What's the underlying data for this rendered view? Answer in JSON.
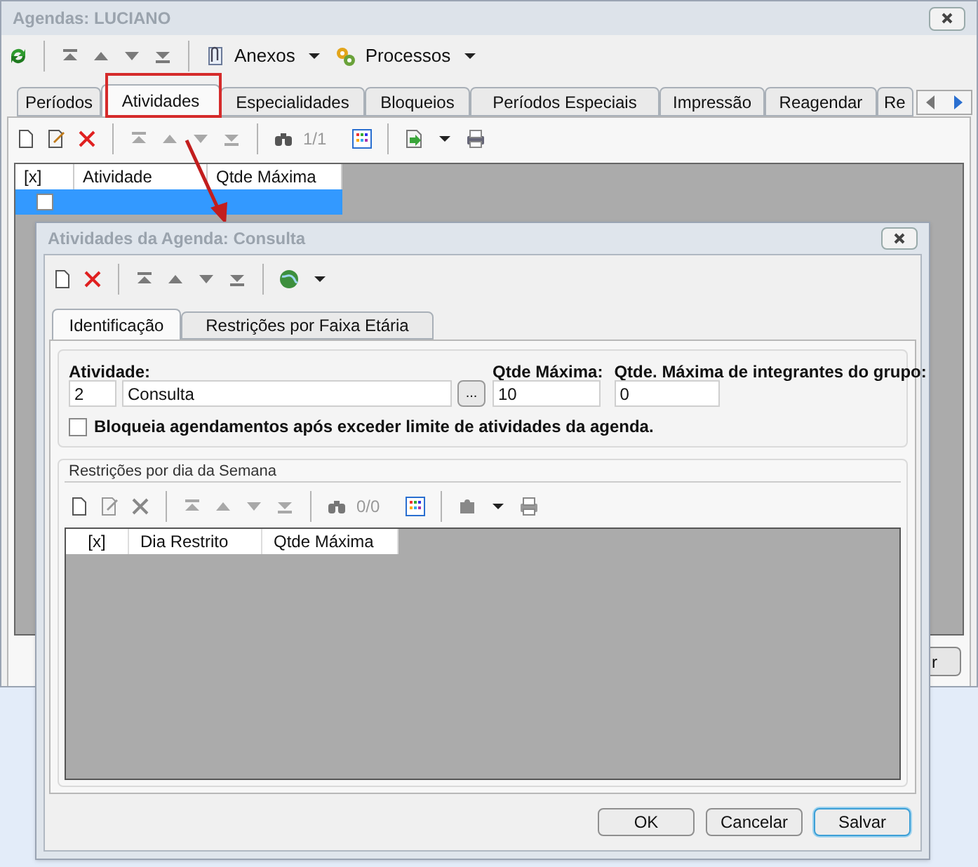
{
  "window": {
    "title": "Agendas: LUCIANO"
  },
  "toolbar": {
    "attachments": "Anexos",
    "processes": "Processos"
  },
  "tabs": [
    {
      "label": "Períodos",
      "selected": false
    },
    {
      "label": "Atividades",
      "selected": true
    },
    {
      "label": "Especialidades",
      "selected": false
    },
    {
      "label": "Bloqueios",
      "selected": false
    },
    {
      "label": "Períodos Especiais",
      "selected": false
    },
    {
      "label": "Impressão",
      "selected": false
    },
    {
      "label": "Reagendar",
      "selected": false
    },
    {
      "label": "Re",
      "selected": false
    }
  ],
  "grid_toolbar": {
    "counter": "1/1"
  },
  "table": {
    "columns": [
      "[x]",
      "Atividade",
      "Qtde Máxima"
    ],
    "rows": [
      {
        "checked": false,
        "selected": true
      }
    ]
  },
  "bottom_button": {
    "label": "r"
  },
  "dialog": {
    "title": "Atividades da Agenda: Consulta",
    "tabs": [
      {
        "label": "Identificação",
        "selected": true
      },
      {
        "label": "Restrições por Faixa Etária",
        "selected": false
      }
    ],
    "activity_label": "Atividade:",
    "activity_code": "2",
    "activity_name": "Consulta",
    "lookup_button": "...",
    "max_label": "Qtde Máxima:",
    "max_value": "10",
    "group_label": "Qtde. Máxima de integrantes do grupo:",
    "group_value": "0",
    "block_option": {
      "label": "Bloqueia agendamentos após exceder limite de atividades da agenda.",
      "checked": false
    },
    "weekday_group": {
      "title": "Restrições por dia da Semana",
      "counter": "0/0",
      "columns": [
        "[x]",
        "Dia Restrito",
        "Qtde Máxima"
      ]
    },
    "buttons": [
      {
        "label": "OK",
        "focused": false
      },
      {
        "label": "Cancelar",
        "focused": false
      },
      {
        "label": "Salvar",
        "focused": true
      }
    ]
  }
}
